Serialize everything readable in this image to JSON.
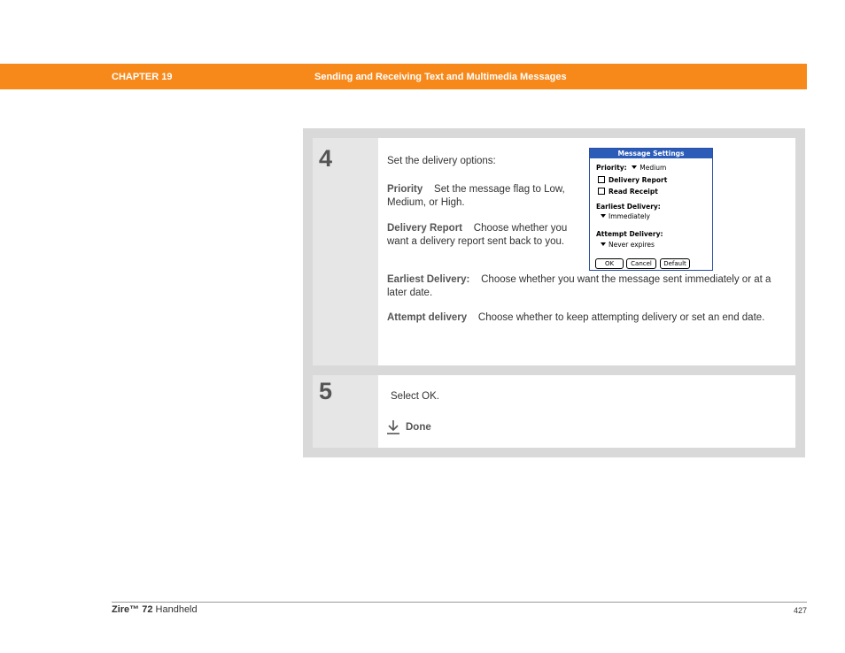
{
  "header": {
    "chapter": "CHAPTER 19",
    "title": "Sending and Receiving Text and Multimedia Messages"
  },
  "steps": [
    {
      "number": "4",
      "intro": "Set the delivery options:",
      "items": [
        {
          "term": "Priority",
          "desc": "Set the message flag to Low, Medium, or High."
        },
        {
          "term": "Delivery Report",
          "desc": "Choose whether you want a delivery report sent back to you."
        },
        {
          "term": "Earliest Delivery:",
          "desc": "Choose whether you want the message sent immediately or at a later date."
        },
        {
          "term": "Attempt delivery",
          "desc": "Choose whether to keep attempting delivery or set an end date."
        }
      ]
    },
    {
      "number": "5",
      "intro": "Select OK.",
      "done_label": "Done"
    }
  ],
  "dialog": {
    "title": "Message Settings",
    "priority_label": "Priority:",
    "priority_value": "Medium",
    "delivery_report": "Delivery Report",
    "read_receipt": "Read Receipt",
    "earliest_label": "Earliest Delivery:",
    "earliest_value": "Immediately",
    "attempt_label": "Attempt Delivery:",
    "attempt_value": "Never expires",
    "btn_ok": "OK",
    "btn_cancel": "Cancel",
    "btn_default": "Default"
  },
  "footer": {
    "product_brand": "Zire™ 72",
    "product_suffix": " Handheld",
    "page": "427"
  },
  "colors": {
    "header_bar": "#f7891b",
    "dialog_title": "#2a5cb8"
  }
}
